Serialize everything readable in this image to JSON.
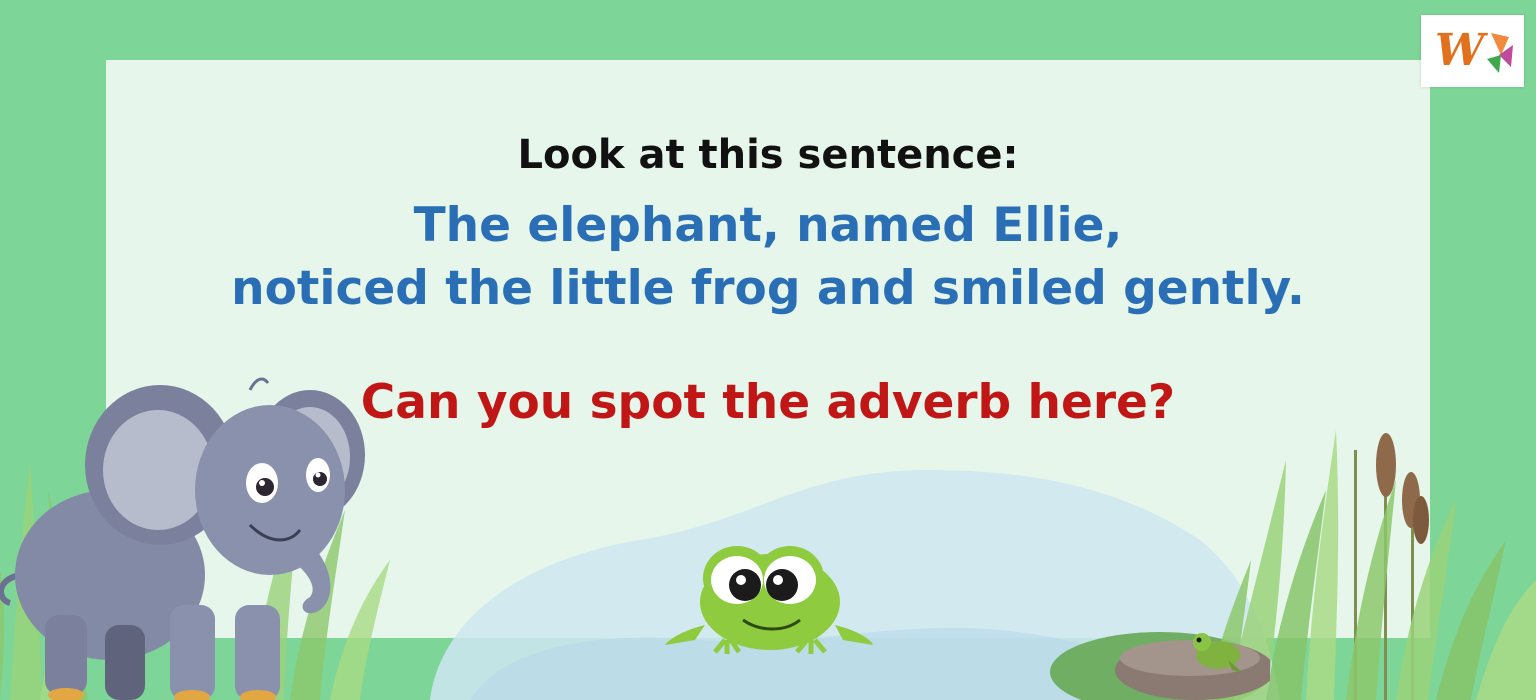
{
  "slide": {
    "heading": "Look at this sentence:",
    "sentence_line1": "The elephant, named Ellie,",
    "sentence_line2": "noticed the little frog and smiled gently.",
    "question": "Can you spot the adverb here?"
  },
  "logo": {
    "letter": "W",
    "icon": "brand-logo-icon"
  },
  "colors": {
    "background": "#7dd597",
    "panel": "#e6f6ea",
    "heading_text": "#111111",
    "sentence_text": "#2a6fb6",
    "question_text": "#c01616",
    "elephant": "#8a92ad",
    "frog": "#8ecb3f"
  },
  "illustrations": [
    "elephant-illustration",
    "frog-illustration",
    "small-frog-illustration",
    "pond-illustration",
    "grass-illustration",
    "cattail-illustration"
  ]
}
